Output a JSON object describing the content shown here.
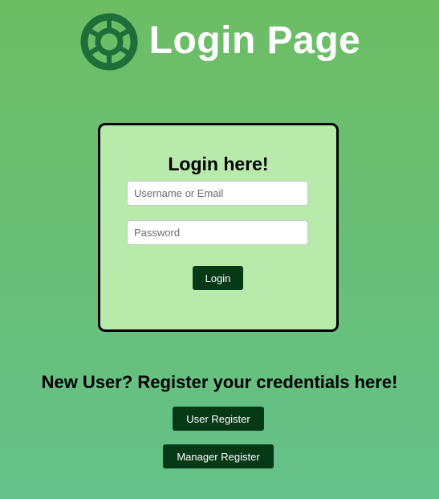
{
  "header": {
    "logo_icon": "ship-wheel-icon",
    "title": "Login Page"
  },
  "login_card": {
    "title": "Login here!",
    "username_placeholder": "Username or Email",
    "username_value": "",
    "password_placeholder": "Password",
    "password_value": "",
    "login_label": "Login"
  },
  "register": {
    "title": "New User? Register your credentials here!",
    "user_register_label": "User Register",
    "manager_register_label": "Manager Register"
  },
  "colors": {
    "background_top": "#6dbd64",
    "background_bottom": "#65c18a",
    "card_background": "#b7eaab",
    "button": "#063a17",
    "logo": "#1f6e3a"
  }
}
